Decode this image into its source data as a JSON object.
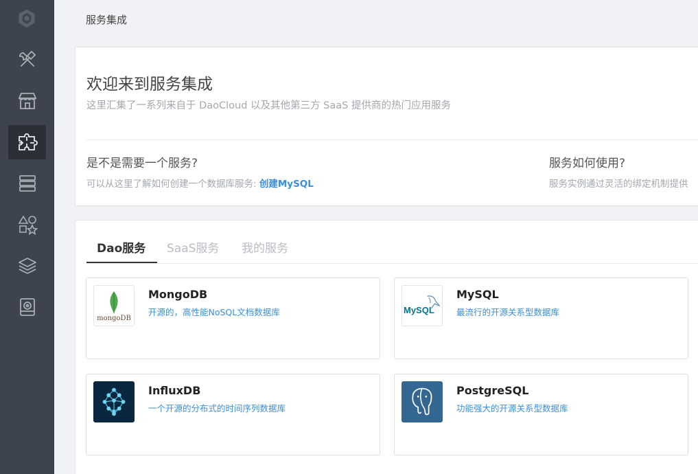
{
  "breadcrumb": "服务集成",
  "sidebar": {
    "items": [
      {
        "name": "tools-icon"
      },
      {
        "name": "store-icon"
      },
      {
        "name": "puzzle-icon",
        "active": true
      },
      {
        "name": "server-icon"
      },
      {
        "name": "shapes-icon"
      },
      {
        "name": "layers-icon"
      },
      {
        "name": "monitor-icon"
      }
    ]
  },
  "welcome": {
    "title": "欢迎来到服务集成",
    "subtitle": "这里汇集了一系列来自于 DaoCloud 以及其他第三方 SaaS 提供商的热门应用服务",
    "need_title": "是不是需要一个服务?",
    "need_desc": "可以从这里了解如何创建一个数据库服务: ",
    "need_link": "创建MySQL",
    "how_title": "服务如何使用?",
    "how_desc": "服务实例通过灵活的绑定机制提供"
  },
  "tabs": [
    {
      "label": "Dao服务",
      "active": true
    },
    {
      "label": "SaaS服务",
      "active": false
    },
    {
      "label": "我的服务",
      "active": false
    }
  ],
  "services": [
    {
      "name": "MongoDB",
      "desc": "开源的，高性能NoSQL文档数据库",
      "logo_text": "mongoDB"
    },
    {
      "name": "MySQL",
      "desc": "最流行的开源关系型数据库",
      "logo_text": "MySQL"
    },
    {
      "name": "InfluxDB",
      "desc": "一个开源的分布式的时间序列数据库"
    },
    {
      "name": "PostgreSQL",
      "desc": "功能强大的开源关系型数据库"
    }
  ],
  "colors": {
    "sidebar": "#3d444e",
    "sidebar_active": "#2b3038",
    "link": "#3a8fdc",
    "background": "#f1f2f5"
  }
}
